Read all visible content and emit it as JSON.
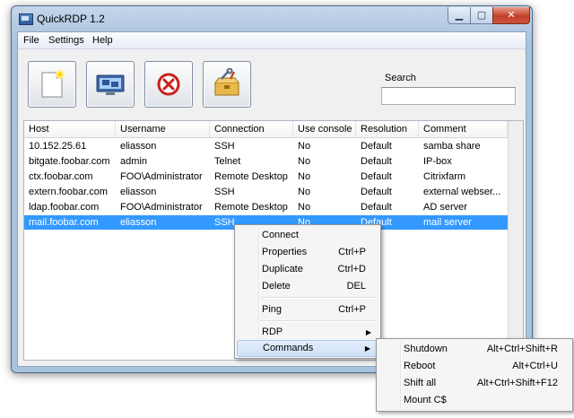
{
  "window": {
    "title": "QuickRDP 1.2"
  },
  "title_buttons": {
    "minimize": "▁",
    "maximize": "▢",
    "close": "✕"
  },
  "menubar": {
    "file": "File",
    "settings": "Settings",
    "help": "Help"
  },
  "toolbar": {
    "new_icon": "new-document-icon",
    "connect_icon": "remote-desktop-icon",
    "delete_icon": "delete-icon",
    "tools_icon": "toolbox-icon"
  },
  "search": {
    "label": "Search",
    "value": "",
    "placeholder": ""
  },
  "table": {
    "columns": [
      "Host",
      "Username",
      "Connection",
      "Use console",
      "Resolution",
      "Comment"
    ],
    "rows": [
      [
        "10.152.25.61",
        "eliasson",
        "SSH",
        "No",
        "Default",
        "samba share"
      ],
      [
        "bitgate.foobar.com",
        "admin",
        "Telnet",
        "No",
        "Default",
        "IP-box"
      ],
      [
        "ctx.foobar.com",
        "FOO\\Administrator",
        "Remote Desktop",
        "No",
        "Default",
        "Citrixfarm"
      ],
      [
        "extern.foobar.com",
        "eliasson",
        "SSH",
        "No",
        "Default",
        "external webser..."
      ],
      [
        "ldap.foobar.com",
        "FOO\\Administrator",
        "Remote Desktop",
        "No",
        "Default",
        "AD server"
      ],
      [
        "mail.foobar.com",
        "eliasson",
        "SSH",
        "No",
        "Default",
        "mail server"
      ]
    ],
    "selected_row": 5
  },
  "context_menu": {
    "connect": {
      "label": "Connect",
      "shortcut": ""
    },
    "properties": {
      "label": "Properties",
      "shortcut": "Ctrl+P"
    },
    "duplicate": {
      "label": "Duplicate",
      "shortcut": "Ctrl+D"
    },
    "delete": {
      "label": "Delete",
      "shortcut": "DEL"
    },
    "ping": {
      "label": "Ping",
      "shortcut": "Ctrl+P"
    },
    "rdp": {
      "label": "RDP",
      "arrow": "▶"
    },
    "commands": {
      "label": "Commands",
      "arrow": "▶"
    }
  },
  "commands_submenu": {
    "shutdown": {
      "label": "Shutdown",
      "shortcut": "Alt+Ctrl+Shift+R"
    },
    "reboot": {
      "label": "Reboot",
      "shortcut": "Alt+Ctrl+U"
    },
    "shift_all": {
      "label": "Shift all",
      "shortcut": "Alt+Ctrl+Shift+F12"
    },
    "mount_c": {
      "label": "Mount C$",
      "shortcut": ""
    }
  },
  "colors": {
    "selection": "#3399ff",
    "titlebar": "#a9c2de",
    "close_button": "#c2412a"
  }
}
